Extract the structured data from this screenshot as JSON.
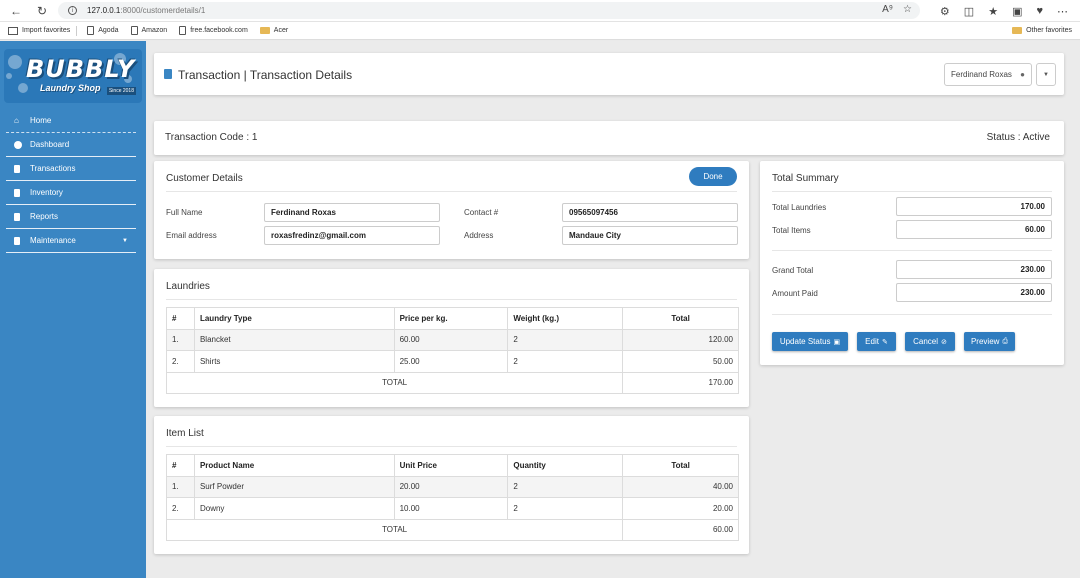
{
  "browser": {
    "url_host": "127.0.0.1",
    "url_path": ":8000/customerdetails/1",
    "bookmarks": [
      "Import favorites",
      "Agoda",
      "Amazon",
      "free.facebook.com",
      "Acer"
    ],
    "other_favorites": "Other favorites"
  },
  "sidebar": {
    "logo_brand": "BUBBLY",
    "logo_sub": "Laundry Shop",
    "logo_since": "Since 2018",
    "items": [
      {
        "label": "Home"
      },
      {
        "label": "Dashboard"
      },
      {
        "label": "Transactions"
      },
      {
        "label": "Inventory"
      },
      {
        "label": "Reports"
      },
      {
        "label": "Maintenance"
      }
    ]
  },
  "header": {
    "title": "Transaction | Transaction Details",
    "user": "Ferdinand Roxas"
  },
  "transaction": {
    "code": "Transaction Code : 1",
    "status": "Status : Active"
  },
  "customer": {
    "title": "Customer Details",
    "done_label": "Done",
    "full_name_label": "Full Name",
    "full_name": "Ferdinand Roxas",
    "email_label": "Email address",
    "email": "roxasfredinz@gmail.com",
    "contact_label": "Contact #",
    "contact": "09565097456",
    "address_label": "Address",
    "address": "Mandaue City"
  },
  "laundries": {
    "title": "Laundries",
    "headers": [
      "#",
      "Laundry Type",
      "Price per kg.",
      "Weight (kg.)",
      "Total"
    ],
    "rows": [
      [
        "1.",
        "Blancket",
        "60.00",
        "2",
        "120.00"
      ],
      [
        "2.",
        "Shirts",
        "25.00",
        "2",
        "50.00"
      ]
    ],
    "total_label": "TOTAL",
    "total": "170.00"
  },
  "items": {
    "title": "Item List",
    "headers": [
      "#",
      "Product Name",
      "Unit Price",
      "Quantity",
      "Total"
    ],
    "rows": [
      [
        "1.",
        "Surf Powder",
        "20.00",
        "2",
        "40.00"
      ],
      [
        "2.",
        "Downy",
        "10.00",
        "2",
        "20.00"
      ]
    ],
    "total_label": "TOTAL",
    "total": "60.00"
  },
  "summary": {
    "title": "Total Summary",
    "total_laundries_label": "Total Laundries",
    "total_laundries": "170.00",
    "total_items_label": "Total Items",
    "total_items": "60.00",
    "grand_total_label": "Grand Total",
    "grand_total": "230.00",
    "amount_paid_label": "Amount Paid",
    "amount_paid": "230.00",
    "buttons": {
      "update_status": "Update Status",
      "edit": "Edit",
      "cancel": "Cancel",
      "preview": "Preview"
    }
  }
}
